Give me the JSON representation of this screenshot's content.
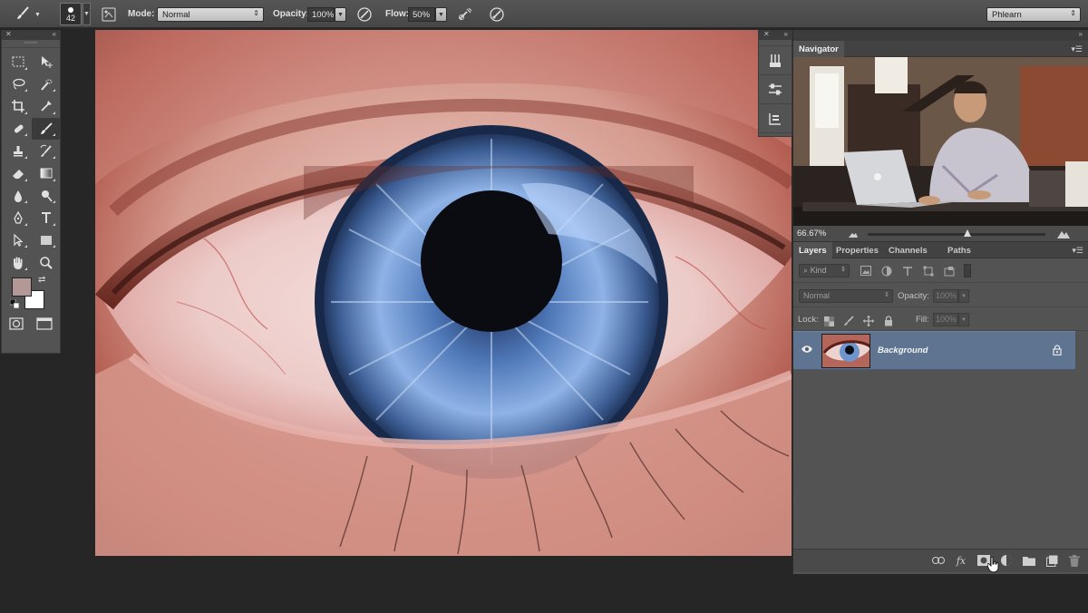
{
  "options_bar": {
    "brush_size": "42",
    "mode_label": "Mode:",
    "mode_value": "Normal",
    "opacity_label": "Opacity:",
    "opacity_value": "100%",
    "flow_label": "Flow:",
    "flow_value": "50%",
    "workspace": "Phlearn"
  },
  "tools": {
    "foreground_color": "#b39898",
    "background_color": "#ffffff"
  },
  "navigator": {
    "tab": "Navigator",
    "zoom": "66.67%",
    "zoom_slider_fraction": 0.56
  },
  "layers_panel": {
    "tabs": [
      "Layers",
      "Properties",
      "Channels",
      "Paths"
    ],
    "kind_filter": "Kind",
    "blend_mode": "Normal",
    "opacity_label": "Opacity:",
    "opacity_value": "100%",
    "lock_label": "Lock:",
    "fill_label": "Fill:",
    "fill_value": "100%",
    "layers": [
      {
        "name": "Background",
        "visible": true,
        "locked": true,
        "selected": true
      }
    ]
  },
  "colors": {
    "accent_selection": "#5e7491",
    "panel": "#535353",
    "background": "#262626"
  }
}
